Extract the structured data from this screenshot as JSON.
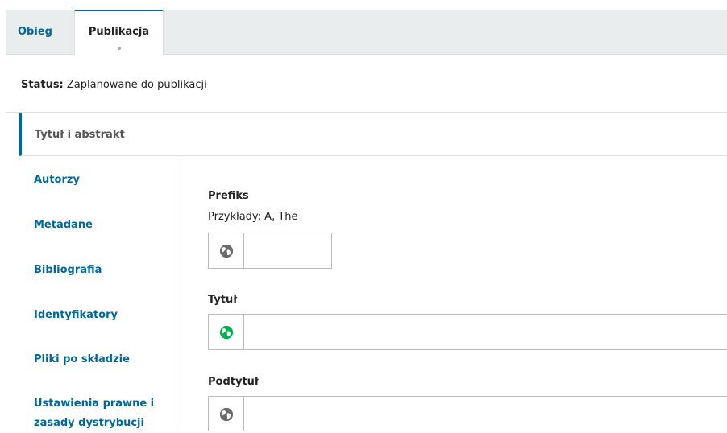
{
  "tabs": [
    {
      "label": "Obieg"
    },
    {
      "label": "Publikacja"
    }
  ],
  "status": {
    "label": "Status:",
    "value": "Zaplanowane do publikacji"
  },
  "sidenav": {
    "active": "Tytuł i abstrakt",
    "items": [
      "Autorzy",
      "Metadane",
      "Bibliografia",
      "Identyfikatory",
      "Pliki po składzie",
      "Ustawienia prawne i zasady dystrybucji"
    ]
  },
  "form": {
    "prefix": {
      "label": "Prefiks",
      "help": "Przykłady: A, The",
      "value": ""
    },
    "title": {
      "label": "Tytuł",
      "value": ""
    },
    "subtitle": {
      "label": "Podtytuł",
      "value": ""
    }
  },
  "icons": {
    "globe_inactive": "globe-icon",
    "globe_active": "globe-icon-complete"
  },
  "colors": {
    "accent": "#006798",
    "globe_inactive": "#6b6b6b",
    "globe_active": "#00b24e"
  }
}
